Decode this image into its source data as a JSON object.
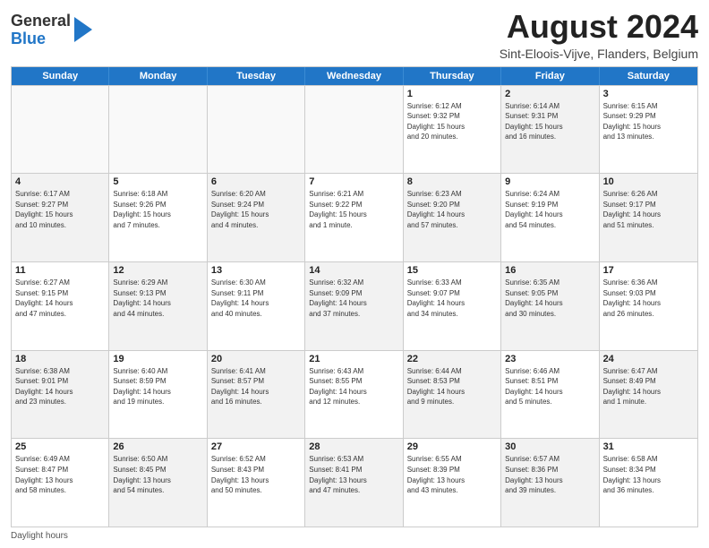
{
  "header": {
    "logo_general": "General",
    "logo_blue": "Blue",
    "main_title": "August 2024",
    "subtitle": "Sint-Eloois-Vijve, Flanders, Belgium"
  },
  "days_of_week": [
    "Sunday",
    "Monday",
    "Tuesday",
    "Wednesday",
    "Thursday",
    "Friday",
    "Saturday"
  ],
  "weeks": [
    [
      {
        "day": "",
        "info": "",
        "shaded": false,
        "empty": true
      },
      {
        "day": "",
        "info": "",
        "shaded": false,
        "empty": true
      },
      {
        "day": "",
        "info": "",
        "shaded": false,
        "empty": true
      },
      {
        "day": "",
        "info": "",
        "shaded": false,
        "empty": true
      },
      {
        "day": "1",
        "info": "Sunrise: 6:12 AM\nSunset: 9:32 PM\nDaylight: 15 hours\nand 20 minutes.",
        "shaded": false,
        "empty": false
      },
      {
        "day": "2",
        "info": "Sunrise: 6:14 AM\nSunset: 9:31 PM\nDaylight: 15 hours\nand 16 minutes.",
        "shaded": true,
        "empty": false
      },
      {
        "day": "3",
        "info": "Sunrise: 6:15 AM\nSunset: 9:29 PM\nDaylight: 15 hours\nand 13 minutes.",
        "shaded": false,
        "empty": false
      }
    ],
    [
      {
        "day": "4",
        "info": "Sunrise: 6:17 AM\nSunset: 9:27 PM\nDaylight: 15 hours\nand 10 minutes.",
        "shaded": true,
        "empty": false
      },
      {
        "day": "5",
        "info": "Sunrise: 6:18 AM\nSunset: 9:26 PM\nDaylight: 15 hours\nand 7 minutes.",
        "shaded": false,
        "empty": false
      },
      {
        "day": "6",
        "info": "Sunrise: 6:20 AM\nSunset: 9:24 PM\nDaylight: 15 hours\nand 4 minutes.",
        "shaded": true,
        "empty": false
      },
      {
        "day": "7",
        "info": "Sunrise: 6:21 AM\nSunset: 9:22 PM\nDaylight: 15 hours\nand 1 minute.",
        "shaded": false,
        "empty": false
      },
      {
        "day": "8",
        "info": "Sunrise: 6:23 AM\nSunset: 9:20 PM\nDaylight: 14 hours\nand 57 minutes.",
        "shaded": true,
        "empty": false
      },
      {
        "day": "9",
        "info": "Sunrise: 6:24 AM\nSunset: 9:19 PM\nDaylight: 14 hours\nand 54 minutes.",
        "shaded": false,
        "empty": false
      },
      {
        "day": "10",
        "info": "Sunrise: 6:26 AM\nSunset: 9:17 PM\nDaylight: 14 hours\nand 51 minutes.",
        "shaded": true,
        "empty": false
      }
    ],
    [
      {
        "day": "11",
        "info": "Sunrise: 6:27 AM\nSunset: 9:15 PM\nDaylight: 14 hours\nand 47 minutes.",
        "shaded": false,
        "empty": false
      },
      {
        "day": "12",
        "info": "Sunrise: 6:29 AM\nSunset: 9:13 PM\nDaylight: 14 hours\nand 44 minutes.",
        "shaded": true,
        "empty": false
      },
      {
        "day": "13",
        "info": "Sunrise: 6:30 AM\nSunset: 9:11 PM\nDaylight: 14 hours\nand 40 minutes.",
        "shaded": false,
        "empty": false
      },
      {
        "day": "14",
        "info": "Sunrise: 6:32 AM\nSunset: 9:09 PM\nDaylight: 14 hours\nand 37 minutes.",
        "shaded": true,
        "empty": false
      },
      {
        "day": "15",
        "info": "Sunrise: 6:33 AM\nSunset: 9:07 PM\nDaylight: 14 hours\nand 34 minutes.",
        "shaded": false,
        "empty": false
      },
      {
        "day": "16",
        "info": "Sunrise: 6:35 AM\nSunset: 9:05 PM\nDaylight: 14 hours\nand 30 minutes.",
        "shaded": true,
        "empty": false
      },
      {
        "day": "17",
        "info": "Sunrise: 6:36 AM\nSunset: 9:03 PM\nDaylight: 14 hours\nand 26 minutes.",
        "shaded": false,
        "empty": false
      }
    ],
    [
      {
        "day": "18",
        "info": "Sunrise: 6:38 AM\nSunset: 9:01 PM\nDaylight: 14 hours\nand 23 minutes.",
        "shaded": true,
        "empty": false
      },
      {
        "day": "19",
        "info": "Sunrise: 6:40 AM\nSunset: 8:59 PM\nDaylight: 14 hours\nand 19 minutes.",
        "shaded": false,
        "empty": false
      },
      {
        "day": "20",
        "info": "Sunrise: 6:41 AM\nSunset: 8:57 PM\nDaylight: 14 hours\nand 16 minutes.",
        "shaded": true,
        "empty": false
      },
      {
        "day": "21",
        "info": "Sunrise: 6:43 AM\nSunset: 8:55 PM\nDaylight: 14 hours\nand 12 minutes.",
        "shaded": false,
        "empty": false
      },
      {
        "day": "22",
        "info": "Sunrise: 6:44 AM\nSunset: 8:53 PM\nDaylight: 14 hours\nand 9 minutes.",
        "shaded": true,
        "empty": false
      },
      {
        "day": "23",
        "info": "Sunrise: 6:46 AM\nSunset: 8:51 PM\nDaylight: 14 hours\nand 5 minutes.",
        "shaded": false,
        "empty": false
      },
      {
        "day": "24",
        "info": "Sunrise: 6:47 AM\nSunset: 8:49 PM\nDaylight: 14 hours\nand 1 minute.",
        "shaded": true,
        "empty": false
      }
    ],
    [
      {
        "day": "25",
        "info": "Sunrise: 6:49 AM\nSunset: 8:47 PM\nDaylight: 13 hours\nand 58 minutes.",
        "shaded": false,
        "empty": false
      },
      {
        "day": "26",
        "info": "Sunrise: 6:50 AM\nSunset: 8:45 PM\nDaylight: 13 hours\nand 54 minutes.",
        "shaded": true,
        "empty": false
      },
      {
        "day": "27",
        "info": "Sunrise: 6:52 AM\nSunset: 8:43 PM\nDaylight: 13 hours\nand 50 minutes.",
        "shaded": false,
        "empty": false
      },
      {
        "day": "28",
        "info": "Sunrise: 6:53 AM\nSunset: 8:41 PM\nDaylight: 13 hours\nand 47 minutes.",
        "shaded": true,
        "empty": false
      },
      {
        "day": "29",
        "info": "Sunrise: 6:55 AM\nSunset: 8:39 PM\nDaylight: 13 hours\nand 43 minutes.",
        "shaded": false,
        "empty": false
      },
      {
        "day": "30",
        "info": "Sunrise: 6:57 AM\nSunset: 8:36 PM\nDaylight: 13 hours\nand 39 minutes.",
        "shaded": true,
        "empty": false
      },
      {
        "day": "31",
        "info": "Sunrise: 6:58 AM\nSunset: 8:34 PM\nDaylight: 13 hours\nand 36 minutes.",
        "shaded": false,
        "empty": false
      }
    ]
  ],
  "footer": {
    "daylight_label": "Daylight hours"
  }
}
